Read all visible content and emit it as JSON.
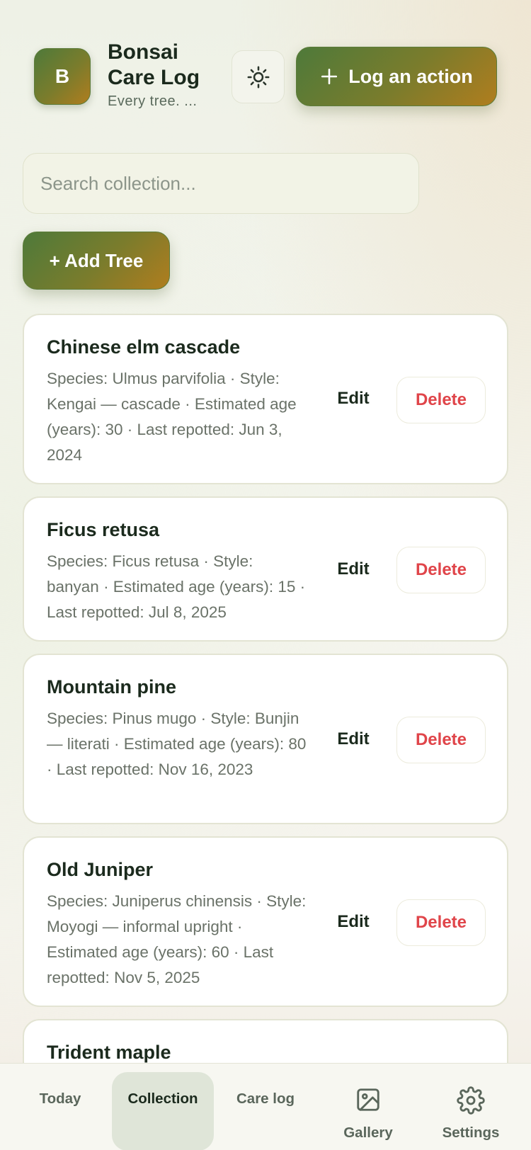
{
  "header": {
    "avatar_letter": "B",
    "title": "Bonsai Care Log",
    "subtitle": "Every tree. ...",
    "theme_icon": "sun-icon",
    "log_button": "Log an action"
  },
  "search": {
    "placeholder": "Search collection..."
  },
  "add_button": "+ Add Tree",
  "trees": [
    {
      "name": "Chinese elm cascade",
      "meta": "Species: Ulmus parvifolia · Style: Kengai — cascade · Estimated age (years): 30 · Last repotted: Jun 3, 2024",
      "edit": "Edit",
      "delete": "Delete"
    },
    {
      "name": "Ficus retusa",
      "meta": "Species: Ficus retusa · Style: banyan · Estimated age (years): 15 · Last repotted: Jul 8, 2025",
      "edit": "Edit",
      "delete": "Delete"
    },
    {
      "name": "Mountain pine",
      "meta": "Species: Pinus mugo · Style: Bunjin — literati · Estimated age (years): 80 · Last repotted: Nov 16, 2023",
      "edit": "Edit",
      "delete": "Delete"
    },
    {
      "name": "Old Juniper",
      "meta": "Species: Juniperus chinensis · Style: Moyogi — informal upright · Estimated age (years): 60 · Last repotted: Nov 5, 2025",
      "edit": "Edit",
      "delete": "Delete"
    },
    {
      "name": "Trident maple"
    }
  ],
  "nav": {
    "today": "Today",
    "collection": "Collection",
    "care_log": "Care log",
    "gallery": "Gallery",
    "settings": "Settings",
    "active": "Collection"
  },
  "colors": {
    "accent_green": "#4e7a3a",
    "accent_gold": "#b07d1e",
    "delete_red": "#e0454a"
  }
}
